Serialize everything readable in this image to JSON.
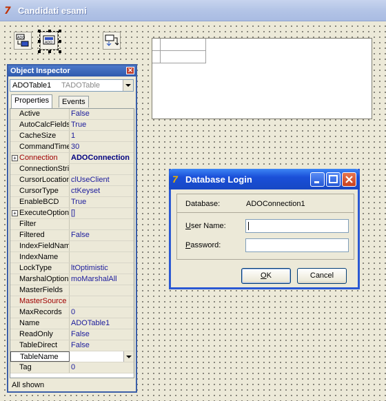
{
  "form": {
    "title": "Candidati esami"
  },
  "inspector": {
    "title": "Object Inspector",
    "object_name": "ADOTable1",
    "object_type": "TADOTable",
    "tabs": [
      "Properties",
      "Events"
    ],
    "properties": [
      {
        "name": "Active",
        "value": "False"
      },
      {
        "name": "AutoCalcFields",
        "value": "True"
      },
      {
        "name": "CacheSize",
        "value": "1"
      },
      {
        "name": "CommandTimeout",
        "value": "30"
      },
      {
        "name": "Connection",
        "value": "ADOConnection",
        "expandable": true,
        "highlight": true
      },
      {
        "name": "ConnectionString",
        "value": ""
      },
      {
        "name": "CursorLocation",
        "value": "clUseClient"
      },
      {
        "name": "CursorType",
        "value": "ctKeyset"
      },
      {
        "name": "EnableBCD",
        "value": "True"
      },
      {
        "name": "ExecuteOptions",
        "value": "[]",
        "expandable": true
      },
      {
        "name": "Filter",
        "value": ""
      },
      {
        "name": "Filtered",
        "value": "False"
      },
      {
        "name": "IndexFieldNames",
        "value": ""
      },
      {
        "name": "IndexName",
        "value": ""
      },
      {
        "name": "LockType",
        "value": "ltOptimistic"
      },
      {
        "name": "MarshalOptions",
        "value": "moMarshalAll"
      },
      {
        "name": "MasterFields",
        "value": ""
      },
      {
        "name": "MasterSource",
        "value": "",
        "red": true
      },
      {
        "name": "MaxRecords",
        "value": "0"
      },
      {
        "name": "Name",
        "value": "ADOTable1"
      },
      {
        "name": "ReadOnly",
        "value": "False"
      },
      {
        "name": "TableDirect",
        "value": "False"
      },
      {
        "name": "TableName",
        "value": "",
        "selected": true
      },
      {
        "name": "Tag",
        "value": "0"
      }
    ],
    "status": "All shown"
  },
  "login": {
    "title": "Database Login",
    "database_label": "Database:",
    "database_value": "ADOConnection1",
    "username_label_u": "U",
    "username_label_rest": "ser Name:",
    "username_value": "",
    "password_label_u": "P",
    "password_label_rest": "assword:",
    "password_value": "",
    "ok_u": "O",
    "ok_rest": "K",
    "cancel_label": "Cancel"
  },
  "colors": {
    "inspector_title": "#2e59ad",
    "dialog_title": "#1a4fd8",
    "value_text": "#1b1b9c"
  }
}
